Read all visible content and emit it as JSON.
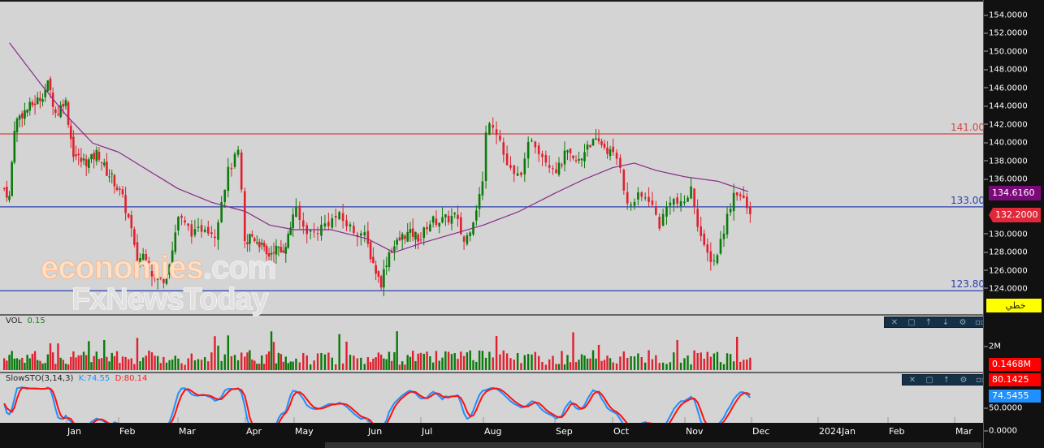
{
  "price_axis": {
    "ticks": [
      "154.0000",
      "152.0000",
      "150.0000",
      "148.0000",
      "146.0000",
      "144.0000",
      "142.0000",
      "140.0000",
      "138.0000",
      "136.0000",
      "130.0000",
      "128.0000",
      "126.0000",
      "124.0000"
    ],
    "tick_values": [
      154,
      152,
      150,
      148,
      146,
      144,
      142,
      140,
      138,
      136,
      130,
      128,
      126,
      124
    ],
    "ma_badge": "134.6160",
    "last_badge": "132.2000",
    "chart_type_button": "خطي"
  },
  "levels": [
    {
      "value": 141.0,
      "label": "141.00",
      "color": "#d04848"
    },
    {
      "value": 133.0,
      "label": "133.00",
      "color": "#2a40b0"
    },
    {
      "value": 123.8,
      "label": "123.80",
      "color": "#2a40b0"
    }
  ],
  "volume_panel": {
    "title": "VOL",
    "value": "0.15",
    "axis_label": "2M",
    "badge": "0.1468M"
  },
  "sto_panel": {
    "title": "SlowSTO(3,14,3)",
    "k": "K:74.55",
    "d": "D:80.14",
    "k_badge": "74.5455",
    "d_badge": "80.1425",
    "ticks": [
      "50.0000",
      "0.0000"
    ]
  },
  "toolbar_icons": [
    "close-icon",
    "maximize-icon",
    "move-up-icon",
    "move-down-icon",
    "settings-icon",
    "more-icon"
  ],
  "months": [
    "Jan",
    "Feb",
    "Mar",
    "Apr",
    "May",
    "Jun",
    "Jul",
    "Aug",
    "Sep",
    "Oct",
    "Nov",
    "Dec",
    "2024Jan",
    "Feb",
    "Mar"
  ],
  "watermark": {
    "line1": "economies.com",
    "line2": "FxNewsToday"
  },
  "colors": {
    "up": "#0a7a0a",
    "down": "#e0202e",
    "ma": "#8a2a8a",
    "k": "#1e90ff",
    "d": "#ff1010"
  },
  "chart_data": {
    "type": "candlestick",
    "note": "approximate close path by month-fraction (0=Jan start), last close 132.2",
    "close_path": [
      [
        -1.2,
        135
      ],
      [
        -1.1,
        134
      ],
      [
        -1.0,
        142
      ],
      [
        -0.9,
        143
      ],
      [
        -0.5,
        145
      ],
      [
        -0.35,
        146.5
      ],
      [
        -0.2,
        143
      ],
      [
        -0.03,
        145
      ],
      [
        0.12,
        139
      ],
      [
        0.28,
        138
      ],
      [
        0.44,
        138
      ],
      [
        0.6,
        139
      ],
      [
        0.75,
        137
      ],
      [
        0.9,
        136
      ],
      [
        1.06,
        134
      ],
      [
        1.2,
        131
      ],
      [
        1.3,
        127
      ],
      [
        1.45,
        128
      ],
      [
        1.6,
        125
      ],
      [
        1.75,
        125
      ],
      [
        1.9,
        128
      ],
      [
        2.0,
        132
      ],
      [
        2.1,
        131
      ],
      [
        2.25,
        130
      ],
      [
        2.4,
        131
      ],
      [
        2.55,
        130
      ],
      [
        2.65,
        134
      ],
      [
        2.75,
        137
      ],
      [
        2.9,
        139
      ],
      [
        3.0,
        128
      ],
      [
        3.1,
        130
      ],
      [
        3.3,
        129
      ],
      [
        3.45,
        127.5
      ],
      [
        3.6,
        128.5
      ],
      [
        3.75,
        128
      ],
      [
        3.9,
        130
      ],
      [
        4.0,
        133
      ],
      [
        4.1,
        131
      ],
      [
        4.25,
        130
      ],
      [
        4.4,
        131
      ],
      [
        4.6,
        132
      ],
      [
        4.8,
        130.5
      ],
      [
        4.95,
        130
      ],
      [
        5.0,
        129
      ],
      [
        5.1,
        127
      ],
      [
        5.25,
        124.5
      ],
      [
        5.4,
        128
      ],
      [
        5.55,
        129
      ],
      [
        5.7,
        130
      ],
      [
        5.85,
        130
      ],
      [
        6.0,
        129.5
      ],
      [
        6.1,
        131
      ],
      [
        6.2,
        131.5
      ],
      [
        6.35,
        131.5
      ],
      [
        6.55,
        132
      ],
      [
        6.7,
        129
      ],
      [
        6.85,
        132
      ],
      [
        7.0,
        136
      ],
      [
        7.05,
        143
      ],
      [
        7.15,
        142
      ],
      [
        7.25,
        140
      ],
      [
        7.3,
        138
      ],
      [
        7.45,
        136
      ],
      [
        7.6,
        138
      ],
      [
        7.65,
        141
      ],
      [
        7.8,
        139
      ],
      [
        7.9,
        138
      ],
      [
        8.05,
        137
      ],
      [
        8.2,
        139
      ],
      [
        8.3,
        138
      ],
      [
        8.45,
        138
      ],
      [
        8.55,
        140
      ],
      [
        8.7,
        140
      ],
      [
        8.8,
        140
      ],
      [
        8.95,
        139
      ],
      [
        9.1,
        138
      ],
      [
        9.2,
        133
      ],
      [
        9.35,
        134
      ],
      [
        9.5,
        134
      ],
      [
        9.65,
        131
      ],
      [
        9.8,
        134
      ],
      [
        9.95,
        133
      ],
      [
        10.1,
        135
      ],
      [
        10.2,
        131
      ],
      [
        10.3,
        128
      ],
      [
        10.45,
        127
      ],
      [
        10.6,
        131
      ],
      [
        10.75,
        135
      ],
      [
        10.85,
        134
      ],
      [
        10.98,
        132.2
      ]
    ],
    "ma_path": [
      [
        -1.1,
        151
      ],
      [
        -0.5,
        146.5
      ],
      [
        0,
        143
      ],
      [
        0.5,
        140
      ],
      [
        1,
        139
      ],
      [
        1.5,
        137
      ],
      [
        2,
        135
      ],
      [
        2.5,
        133.5
      ],
      [
        3,
        132.5
      ],
      [
        3.5,
        131
      ],
      [
        4,
        130.5
      ],
      [
        4.5,
        130.5
      ],
      [
        5,
        129.5
      ],
      [
        5.5,
        128
      ],
      [
        6,
        129
      ],
      [
        6.5,
        130
      ],
      [
        7,
        131
      ],
      [
        7.5,
        132.5
      ],
      [
        8,
        134.5
      ],
      [
        8.5,
        136
      ],
      [
        9,
        137.3
      ],
      [
        9.3,
        137.8
      ],
      [
        9.6,
        137
      ],
      [
        10,
        136.3
      ],
      [
        10.5,
        135.8
      ],
      [
        10.98,
        134.6
      ]
    ],
    "ylim": [
      122.5,
      155
    ],
    "sto_ylim": [
      0,
      100
    ]
  }
}
